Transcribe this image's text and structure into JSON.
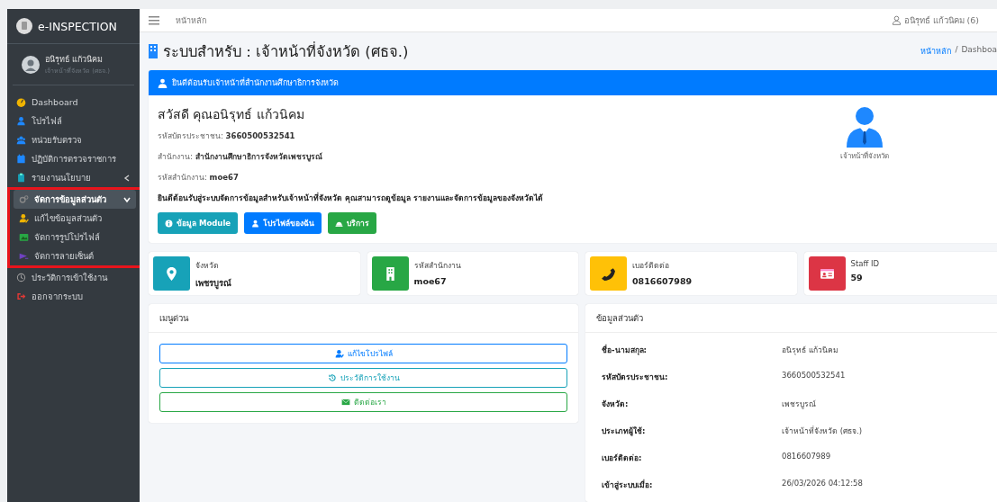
{
  "sidebar": {
    "brand": "e-INSPECTION",
    "user": {
      "name": "อนิรุทธ์ แก้วนิคม",
      "role": "เจ้าหน้าที่จังหวัด (ศธจ.)"
    },
    "items": [
      {
        "label": "Dashboard",
        "kind": "link",
        "highlighted": false
      },
      {
        "label": "โปรไฟล์",
        "kind": "link",
        "highlighted": false
      },
      {
        "label": "หน่วยรับตรวจ",
        "kind": "link",
        "highlighted": false
      },
      {
        "label": "ปฏิบัติการตรวจราชการ",
        "kind": "link",
        "highlighted": false
      },
      {
        "label": "รายงานนโยบาย",
        "kind": "group",
        "expanded": false,
        "highlighted": false
      },
      {
        "label": "จัดการข้อมูลส่วนตัว",
        "kind": "group",
        "expanded": true,
        "highlighted": true,
        "children": [
          {
            "label": "แก้ไขข้อมูลส่วนตัว"
          },
          {
            "label": "จัดการรูปโปรไฟล์"
          },
          {
            "label": "จัดการลายเซ็นต์"
          }
        ]
      },
      {
        "label": "ประวัติการเข้าใช้งาน",
        "kind": "link",
        "highlighted": false
      },
      {
        "label": "ออกจากระบบ",
        "kind": "link",
        "highlighted": false
      }
    ]
  },
  "topbar": {
    "home": "หน้าหลัก",
    "user": "อนิรุทธ์ แก้วนิคม (6)"
  },
  "page_header": {
    "title": "ระบบสำหรับ : เจ้าหน้าที่จังหวัด (ศธจ.)",
    "separator": "/",
    "breadcrumb": [
      {
        "label": "หน้าหลัก",
        "kind": "link"
      },
      {
        "label": "Dashboa",
        "kind": "current"
      }
    ]
  },
  "welcome": {
    "banner": "ยินดีต้อนรับเจ้าหน้าที่สำนักงานศึกษาธิการจังหวัด",
    "greeting": "สวัสดี คุณอนิรุทธ์ แก้วนิคม",
    "fields": [
      "รหัสบัตรประชาชน: **3660500532541**",
      "สำนักงาน: **สำนักงานศึกษาธิการจังหวัดเพชรบูรณ์**",
      "รหัสสำนักงาน: **moe67**"
    ],
    "message": "ยินดีต้อนรับสู่ระบบจัดการข้อมูลสำหรับเจ้าหน้าที่จังหวัด คุณสามารถดูข้อมูล รายงานและจัดการข้อมูลของจังหวัดได้",
    "buttons": [
      {
        "label": "ข้อมูล Module",
        "color": "#17a2b8"
      },
      {
        "label": "โปรไฟล์ของฉัน",
        "color": "#007bff"
      },
      {
        "label": "บริการ",
        "color": "#28a745"
      }
    ],
    "role_label": "เจ้าหน้าที่จังหวัด"
  },
  "info_cards": [
    {
      "label": "จังหวัด",
      "value": "เพชรบูรณ์",
      "color": "#17a2b8"
    },
    {
      "label": "รหัสสำนักงาน",
      "value": "moe67",
      "color": "#28a745"
    },
    {
      "label": "เบอร์ติดต่อ",
      "value": "0816607989",
      "color": "#ffc107"
    },
    {
      "label": "Staff ID",
      "value": "59",
      "color": "#dc3545"
    }
  ],
  "quick_menu": {
    "title": "เมนูด่วน",
    "buttons": [
      {
        "label": "แก้ไขโปรไฟล์",
        "color": "#007bff"
      },
      {
        "label": "ประวัติการใช้งาน",
        "color": "#17a2b8"
      },
      {
        "label": "ติดต่อเรา",
        "color": "#28a745"
      }
    ]
  },
  "personal": {
    "title": "ข้อมูลส่วนตัว",
    "rows": [
      {
        "label": "ชื่อ-นามสกุล:",
        "value": "อนิรุทธ์ แก้วนิคม"
      },
      {
        "label": "รหัสบัตรประชาชน:",
        "value": "3660500532541"
      },
      {
        "label": "จังหวัด:",
        "value": "เพชรบูรณ์"
      },
      {
        "label": "ประเภทผู้ใช้:",
        "value": "เจ้าหน้าที่จังหวัด (ศธจ.)"
      },
      {
        "label": "เบอร์ติดต่อ:",
        "value": "0816607989"
      },
      {
        "label": "เข้าสู่ระบบเมื่อ:",
        "value": "26/03/2026 04:12:58"
      }
    ]
  }
}
